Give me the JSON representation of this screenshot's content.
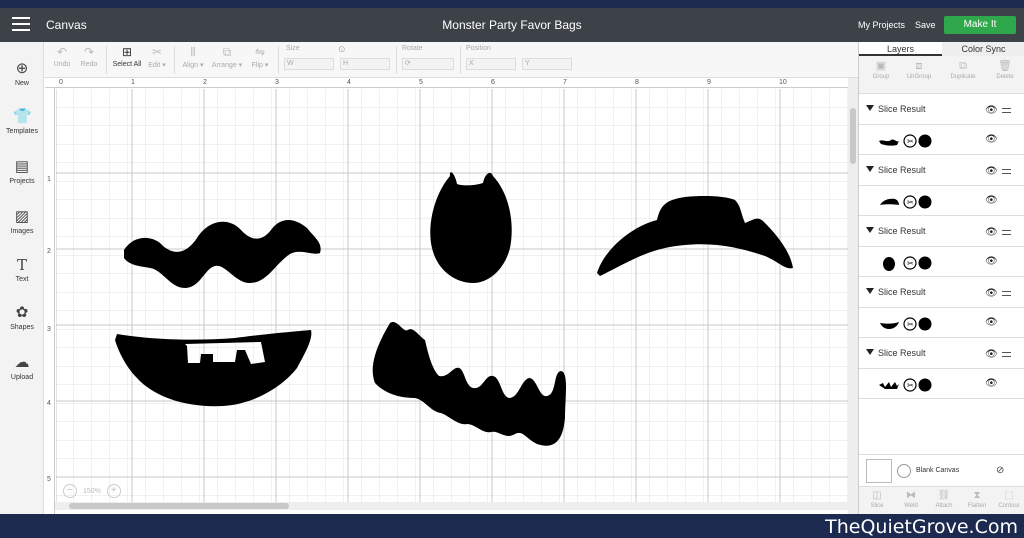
{
  "header": {
    "app_name": "Canvas",
    "document_title": "Monster Party Favor Bags",
    "my_projects": "My Projects",
    "save": "Save",
    "make_it": "Make It"
  },
  "toolbar": {
    "undo": "Undo",
    "redo": "Redo",
    "select_all": "Select All",
    "edit": "Edit",
    "align": "Align",
    "arrange": "Arrange",
    "flip": "Flip",
    "size": "Size",
    "w": "W",
    "h": "H",
    "rotate": "Rotate",
    "position": "Position",
    "x": "X",
    "y": "Y"
  },
  "sidebar": {
    "items": [
      {
        "label": "New",
        "icon": "plus-circle-icon"
      },
      {
        "label": "Templates",
        "icon": "tshirt-icon"
      },
      {
        "label": "Projects",
        "icon": "projects-icon"
      },
      {
        "label": "Images",
        "icon": "images-icon"
      },
      {
        "label": "Text",
        "icon": "text-icon"
      },
      {
        "label": "Shapes",
        "icon": "shapes-icon"
      },
      {
        "label": "Upload",
        "icon": "upload-icon"
      }
    ]
  },
  "ruler": {
    "top": [
      "0",
      "1",
      "2",
      "3",
      "4",
      "5",
      "6",
      "7",
      "8",
      "9",
      "10"
    ],
    "left": [
      "1",
      "2",
      "3",
      "4",
      "5"
    ]
  },
  "zoom": {
    "level": "150%"
  },
  "panel": {
    "tab_layers": "Layers",
    "tab_color_sync": "Color Sync",
    "tools": [
      "Group",
      "UnGroup",
      "Duplicate",
      "Delete"
    ],
    "layers": [
      {
        "title": "Slice Result"
      },
      {
        "title": "Slice Result"
      },
      {
        "title": "Slice Result"
      },
      {
        "title": "Slice Result"
      },
      {
        "title": "Slice Result"
      }
    ],
    "blank_canvas": "Blank Canvas",
    "bottom_tools": [
      "Slice",
      "Weld",
      "Attach",
      "Flatten",
      "Contour"
    ]
  },
  "footer": {
    "site": "TheQuietGrove.Com"
  },
  "colors": {
    "header_bg": "#3d4248",
    "make_it": "#2ea84a",
    "frame": "#1b2a4e"
  }
}
